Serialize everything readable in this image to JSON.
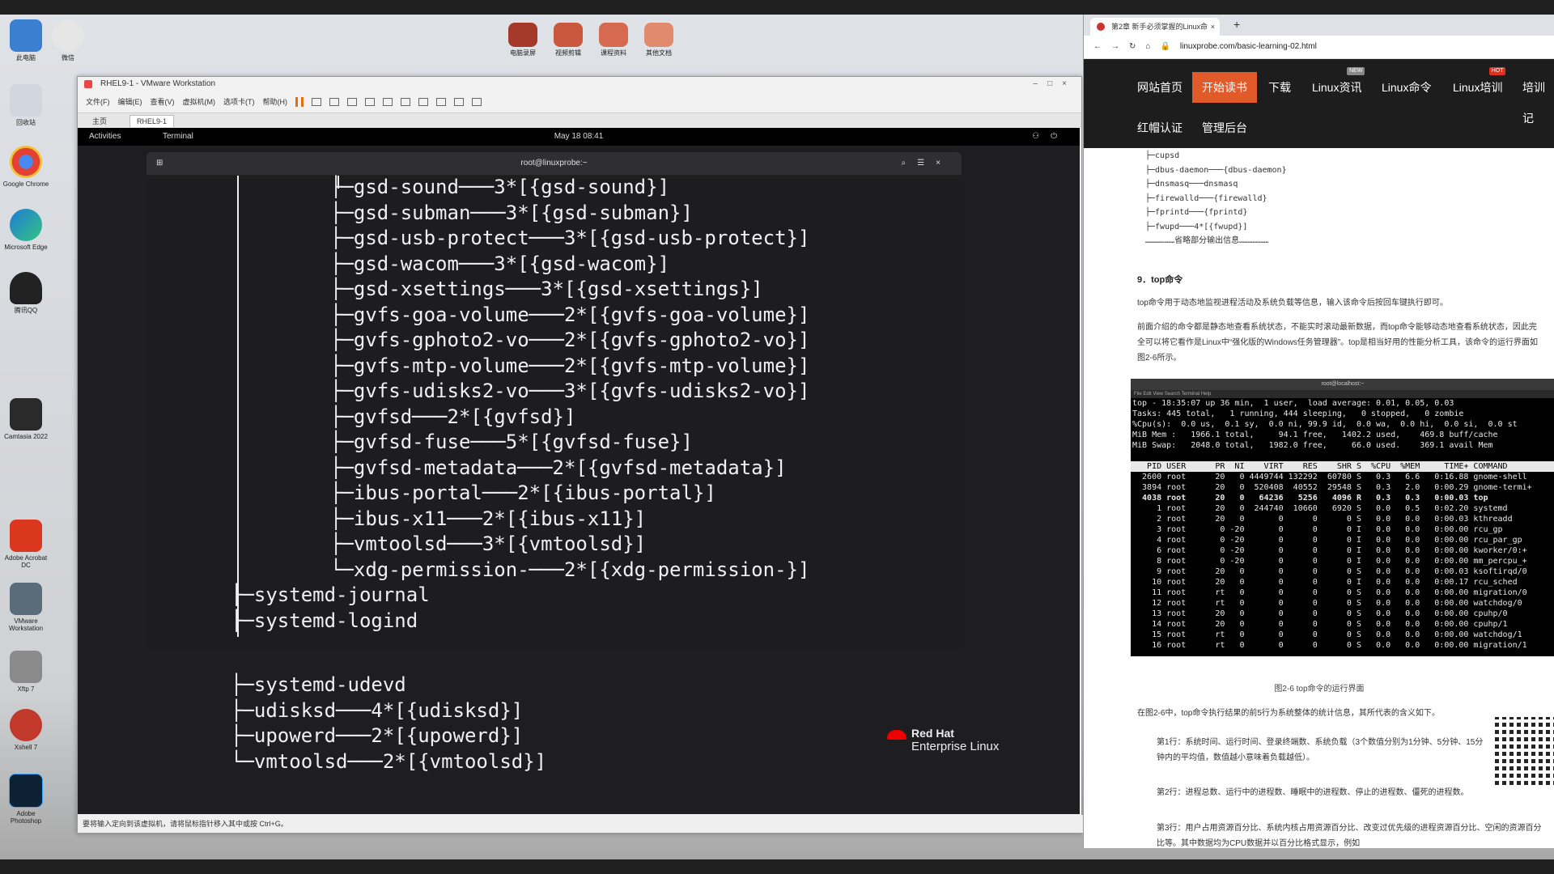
{
  "desktop": {
    "icons": [
      {
        "label": "此电脑"
      },
      {
        "label": "微信"
      },
      {
        "label": "回收站"
      },
      {
        "label": "Google Chrome"
      },
      {
        "label": "Microsoft Edge"
      },
      {
        "label": "腾讯QQ"
      },
      {
        "label": "Camtasia 2022"
      },
      {
        "label": "Adobe Acrobat DC"
      },
      {
        "label": "VMware Workstation"
      },
      {
        "label": "Xftp 7"
      },
      {
        "label": "Xshell 7"
      },
      {
        "label": "Adobe Photoshop"
      }
    ],
    "top_icons": [
      {
        "label": "电脑录屏"
      },
      {
        "label": "视频剪辑"
      },
      {
        "label": "课程资料"
      },
      {
        "label": "其他文档"
      }
    ]
  },
  "vmware": {
    "title": "RHEL9-1 - VMware Workstation",
    "menu": [
      "文件(F)",
      "编辑(E)",
      "查看(V)",
      "虚拟机(M)",
      "选项卡(T)",
      "帮助(H)"
    ],
    "tabs": [
      "主页",
      "RHEL9-1"
    ],
    "status": "要将输入定向到该虚拟机，请将鼠标指针移入其中或按 Ctrl+G。"
  },
  "gnome": {
    "activities": "Activities",
    "app": "Terminal",
    "clock": "May 18  08:41"
  },
  "terminal": {
    "title": "root@linuxprobe:~",
    "lines": [
      "          ├─gsd-sound───3*[{gsd-sound}]",
      "          ├─gsd-subman───3*[{gsd-subman}]",
      "          ├─gsd-usb-protect───3*[{gsd-usb-protect}]",
      "          ├─gsd-wacom───3*[{gsd-wacom}]",
      "          ├─gsd-xsettings───3*[{gsd-xsettings}]",
      "          ├─gvfs-goa-volume───2*[{gvfs-goa-volume}]",
      "          ├─gvfs-gphoto2-vo───2*[{gvfs-gphoto2-vo}]",
      "          ├─gvfs-mtp-volume───2*[{gvfs-mtp-volume}]",
      "          ├─gvfs-udisks2-vo───3*[{gvfs-udisks2-vo}]",
      "          ├─gvfsd───2*[{gvfsd}]",
      "          ├─gvfsd-fuse───5*[{gvfsd-fuse}]",
      "          ├─gvfsd-metadata───2*[{gvfsd-metadata}]",
      "          ├─ibus-portal───2*[{ibus-portal}]",
      "          ├─ibus-x11───2*[{ibus-x11}]",
      "          ├─vmtoolsd───3*[{vmtoolsd}]",
      "          └─xdg-permission-───2*[{xdg-permission-}]",
      "├─systemd-journal",
      "├─systemd-logind",
      "├─systemd-udevd",
      "├─udisksd───4*[{udisksd}]",
      "├─upowerd───2*[{upowerd}]",
      "└─vmtoolsd───2*[{vmtoolsd}]"
    ]
  },
  "redhat": {
    "line1": "Red Hat",
    "line2": "Enterprise Linux"
  },
  "browser": {
    "tab_title": "第2章 新手必须掌握的Linux命",
    "url": "linuxprobe.com/basic-learning-02.html",
    "nav": [
      "网站首页",
      "开始读书",
      "下载",
      "Linux资讯",
      "Linux命令",
      "Linux培训",
      "培训记",
      "红帽认证",
      "管理后台"
    ],
    "nav_badges": [
      "NEW",
      "HOT"
    ],
    "tree": [
      "├─cupsd",
      "├─dbus-daemon───{dbus-daemon}",
      "├─dnsmasq───dnsmasq",
      "├─firewalld───{firewalld}",
      "├─fprintd───{fprintd}",
      "├─fwupd───4*[{fwupd}]",
      "………………省略部分输出信息………………"
    ],
    "section_title": "9．top命令",
    "para1": "top命令用于动态地监视进程活动及系统负载等信息，输入该命令后按回车键执行即可。",
    "para2": "前面介绍的命令都是静态地查看系统状态，不能实时滚动最新数据，而top命令能够动态地查看系统状态，因此完全可以将它看作是Linux中“强化版的Windows任务管理器”。top是相当好用的性能分析工具，该命令的运行界面如图2-6所示。",
    "shot_title": "root@localhost:~",
    "shot_menu": "File   Edit   View   Search   Terminal   Help",
    "top_lines": [
      "top - 18:35:07 up 36 min,  1 user,  load average: 0.01, 0.05, 0.03",
      "Tasks: 445 total,   1 running, 444 sleeping,   0 stopped,   0 zombie",
      "%Cpu(s):  0.0 us,  0.1 sy,  0.0 ni, 99.9 id,  0.0 wa,  0.0 hi,  0.0 si,  0.0 st",
      "MiB Mem :   1966.1 total,     94.1 free,   1402.2 used,    469.8 buff/cache",
      "MiB Swap:   2048.0 total,   1982.0 free,     66.0 used.    369.1 avail Mem"
    ],
    "top_header": "   PID USER      PR  NI    VIRT    RES    SHR S  %CPU  %MEM     TIME+ COMMAND",
    "top_rows": [
      "  2600 root      20   0 4449744 132292  60780 S   0.3   6.6   0:16.88 gnome-shell",
      "  3894 root      20   0  520408  40552  29548 S   0.3   2.0   0:00.29 gnome-termi+",
      "  4038 root      20   0   64236   5256   4096 R   0.3   0.3   0:00.03 top",
      "     1 root      20   0  244740  10660   6920 S   0.0   0.5   0:02.20 systemd",
      "     2 root      20   0       0      0      0 S   0.0   0.0   0:00.03 kthreadd",
      "     3 root       0 -20       0      0      0 I   0.0   0.0   0:00.00 rcu_gp",
      "     4 root       0 -20       0      0      0 I   0.0   0.0   0:00.00 rcu_par_gp",
      "     6 root       0 -20       0      0      0 I   0.0   0.0   0:00.00 kworker/0:+",
      "     8 root       0 -20       0      0      0 I   0.0   0.0   0:00.00 mm_percpu_+",
      "     9 root      20   0       0      0      0 S   0.0   0.0   0:00.03 ksoftirqd/0",
      "    10 root      20   0       0      0      0 I   0.0   0.0   0:00.17 rcu_sched",
      "    11 root      rt   0       0      0      0 S   0.0   0.0   0:00.00 migration/0",
      "    12 root      rt   0       0      0      0 S   0.0   0.0   0:00.00 watchdog/0",
      "    13 root      20   0       0      0      0 S   0.0   0.0   0:00.00 cpuhp/0",
      "    14 root      20   0       0      0      0 S   0.0   0.0   0:00.00 cpuhp/1",
      "    15 root      rt   0       0      0      0 S   0.0   0.0   0:00.00 watchdog/1",
      "    16 root      rt   0       0      0      0 S   0.0   0.0   0:00.00 migration/1"
    ],
    "figure_caption": "图2-6  top命令的运行界面",
    "para3": "在图2-6中，top命令执行结果的前5行为系统整体的统计信息，其所代表的含义如下。",
    "item1": "第1行：系统时间、运行时间、登录终端数、系统负载（3个数值分别为1分钟、5分钟、15分钟内的平均值，数值越小意味着负载越低）。",
    "item2": "第2行：进程总数、运行中的进程数、睡眠中的进程数、停止的进程数、僵死的进程数。",
    "item3": "第3行：用户占用资源百分比、系统内核占用资源百分比、改变过优先级的进程资源百分比、空闲的资源百分比等。其中数据均为CPU数据并以百分比格式显示，例如"
  }
}
